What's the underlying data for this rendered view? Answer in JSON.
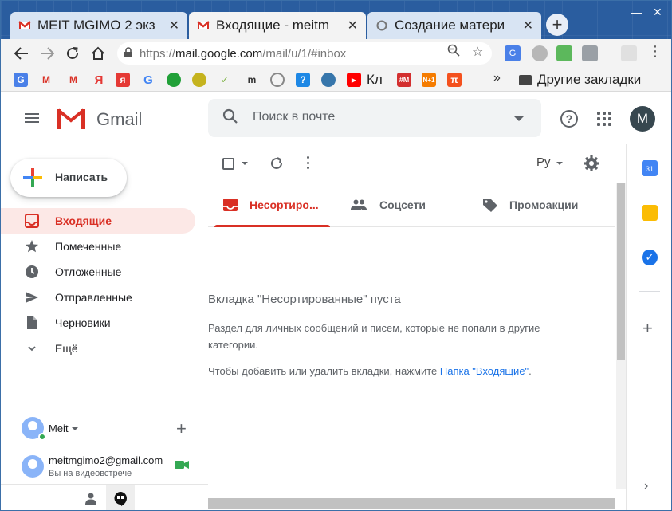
{
  "browser": {
    "tabs": [
      {
        "title": "MEIT MGIMO 2 экз",
        "icon": "gmail-favicon"
      },
      {
        "title": "Входящие - meitm",
        "icon": "gmail-favicon"
      },
      {
        "title": "Создание матери",
        "icon": "loading-favicon"
      }
    ],
    "address": {
      "scheme": "https://",
      "host": "mail.google.com",
      "path": "/mail/u/1/#inbox"
    },
    "bookmarks": {
      "kl_label": "Кл",
      "more": "»",
      "other_label": "Другие закладки"
    }
  },
  "gmail": {
    "brand": "Gmail",
    "search_placeholder": "Поиск в почте",
    "avatar_letter": "M",
    "compose_label": "Написать",
    "nav": [
      {
        "label": "Входящие",
        "icon": "inbox-icon"
      },
      {
        "label": "Помеченные",
        "icon": "star-icon"
      },
      {
        "label": "Отложенные",
        "icon": "clock-icon"
      },
      {
        "label": "Отправленные",
        "icon": "send-icon"
      },
      {
        "label": "Черновики",
        "icon": "draft-icon"
      },
      {
        "label": "Ещё",
        "icon": "chevron-down-icon"
      }
    ],
    "hangouts": {
      "user": "Meit",
      "contact_email": "meitmgimo2@gmail.com",
      "contact_status": "Вы на видеовстрече"
    },
    "toolbar": {
      "lang": "Ру"
    },
    "categories": [
      {
        "label": "Несортиро...",
        "icon": "inbox-tab-icon"
      },
      {
        "label": "Соцсети",
        "icon": "people-icon"
      },
      {
        "label": "Промоакции",
        "icon": "tag-icon"
      }
    ],
    "empty": {
      "title": "Вкладка \"Несортированные\" пуста",
      "description": "Раздел для личных сообщений и писем, которые не попали в другие категории.",
      "hint_prefix": "Чтобы добавить или удалить вкладки, нажмите ",
      "hint_link": "Папка \"Входящие\"",
      "hint_suffix": "."
    }
  },
  "colors": {
    "accent_red": "#d93025",
    "active_bg": "#fce8e6",
    "link_blue": "#1a73e8"
  }
}
